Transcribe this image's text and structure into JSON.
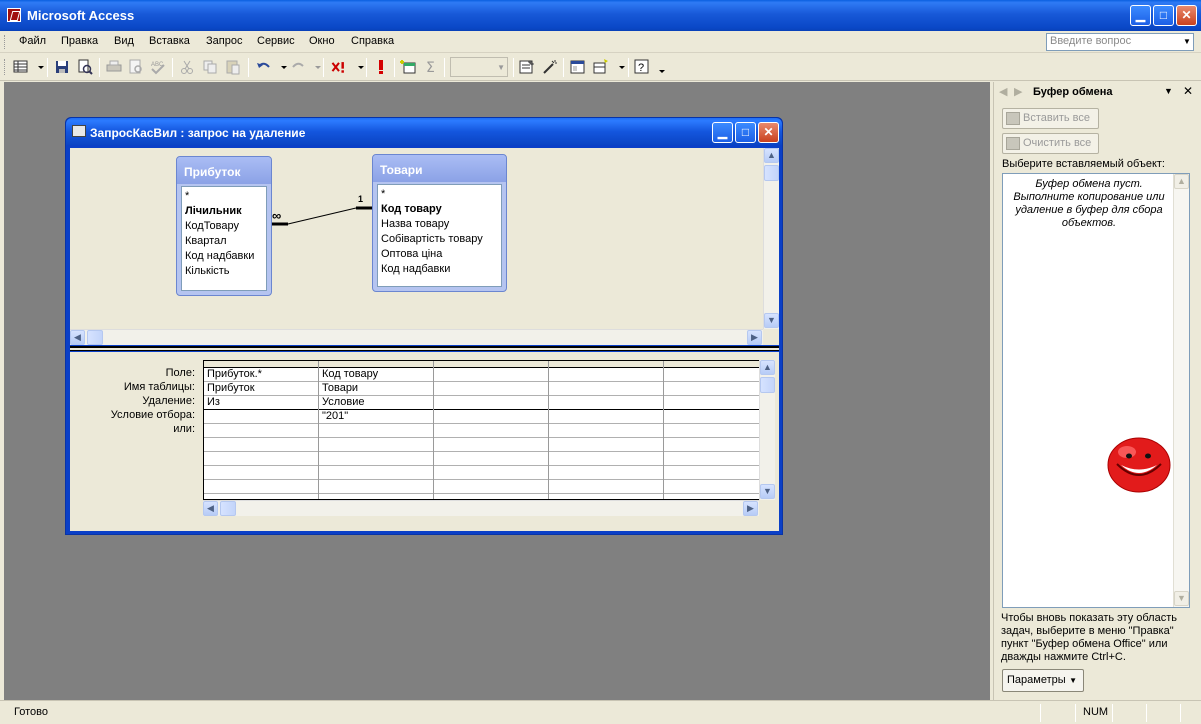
{
  "app": {
    "title": "Microsoft Access"
  },
  "menu": {
    "items": [
      "Файл",
      "Правка",
      "Вид",
      "Вставка",
      "Запрос",
      "Сервис",
      "Окно",
      "Справка"
    ],
    "ask_placeholder": "Введите вопрос"
  },
  "query_window": {
    "title": "ЗапросКасВил : запрос на удаление",
    "tables": [
      {
        "name": "Прибуток",
        "fields": [
          "*",
          "Лічильник",
          "КодТовару",
          "Квартал",
          "Код надбавки",
          "Кількість"
        ],
        "key_field": "Лічильник"
      },
      {
        "name": "Товари",
        "fields": [
          "*",
          "Код товару",
          "Назва товару",
          "Собівартість товару",
          "Оптова ціна",
          "Код надбавки"
        ],
        "key_field": "Код товару"
      }
    ],
    "relationship": {
      "many": "∞",
      "one": "1"
    },
    "grid": {
      "row_labels": [
        "Поле:",
        "Имя таблицы:",
        "Удаление:",
        "Условие отбора:",
        "или:"
      ],
      "columns": [
        {
          "field": "Прибуток.*",
          "table": "Прибуток",
          "delete": "Из",
          "criteria": ""
        },
        {
          "field": "Код товару",
          "table": "Товари",
          "delete": "Условие",
          "criteria": "\"201\""
        },
        {
          "field": "",
          "table": "",
          "delete": "",
          "criteria": ""
        },
        {
          "field": "",
          "table": "",
          "delete": "",
          "criteria": ""
        },
        {
          "field": "",
          "table": "",
          "delete": "",
          "criteria": ""
        }
      ]
    }
  },
  "task_pane": {
    "title": "Буфер обмена",
    "paste_all": "Вставить все",
    "clear_all": "Очистить все",
    "select_label": "Выберите вставляемый объект:",
    "empty_text": "Буфер обмена пуст. Выполните копирование или удаление в буфер для сбора объектов.",
    "footer_text": "Чтобы вновь показать эту область задач, выберите в меню \"Правка\" пункт \"Буфер обмена Office\" или дважды нажмите Ctrl+C.",
    "params_label": "Параметры"
  },
  "status": {
    "text": "Готово",
    "num": "NUM"
  }
}
